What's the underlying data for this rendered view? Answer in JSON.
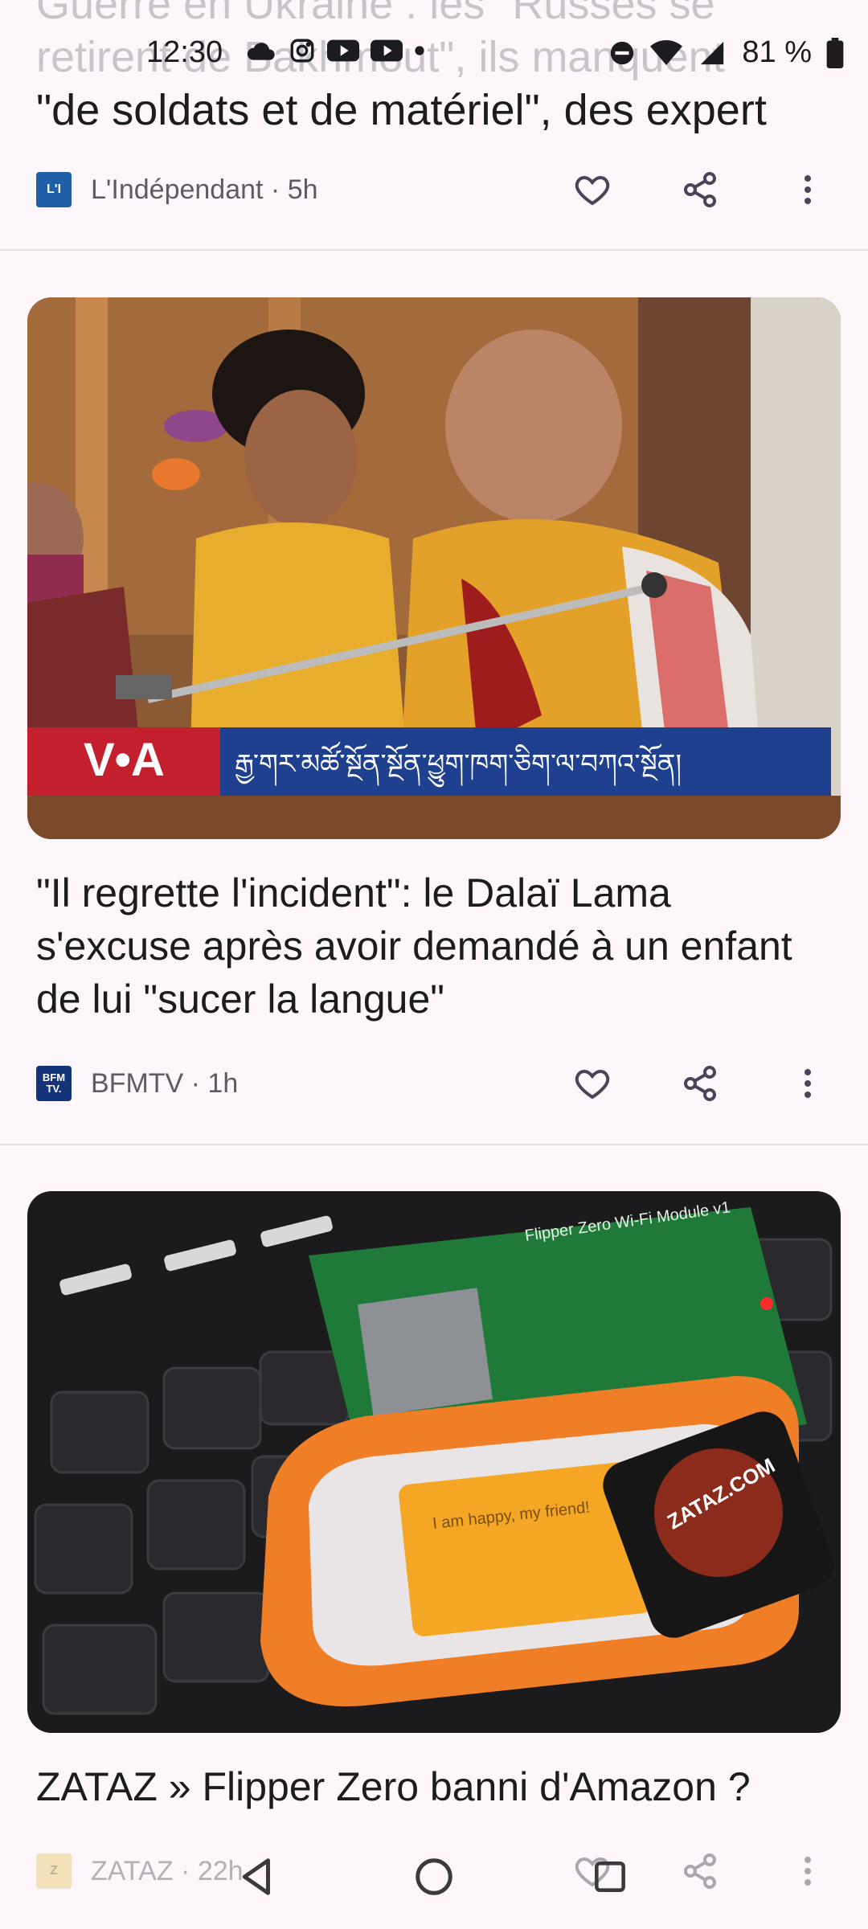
{
  "status_bar": {
    "time": "12:30",
    "battery": "81 %",
    "icons": [
      "cloud-icon",
      "instagram-icon",
      "youtube-icon",
      "youtube-icon",
      "dot-icon",
      "dnd-icon",
      "wifi-icon",
      "signal-icon",
      "battery-icon"
    ]
  },
  "articles": [
    {
      "title_faded": "Guerre en Ukraine : les \"Russes se retirent de Bakhmout\", ils manquent",
      "title_visible": "\"de soldats et de matériel\", des expert",
      "source": "L'Indépendant",
      "age": "5h",
      "source_meta": "L'Indépendant · 5h",
      "logo_text": "L'I",
      "logo_color": "#1e5fa8"
    },
    {
      "title": "\"Il regrette l'incident\": le Dalaï Lama s'excuse après avoir demandé à un enfant de lui \"sucer la langue\"",
      "source": "BFMTV",
      "age": "1h",
      "source_meta": "BFMTV · 1h",
      "logo_text": "BFM TV.",
      "logo_color": "#14347a",
      "image_caption_voa": "V•A",
      "image_caption_tibetan": "རྒྱ་གར་མཚོ་སྔོན་སྔོན་ཕྱུག་ཁག་ཅིག་ལ་བཀའ་སྔོན།"
    },
    {
      "title": "ZATAZ » Flipper Zero banni d'Amazon ?",
      "source": "ZATAZ",
      "age": "22h",
      "source_meta": "ZATAZ · 22h",
      "logo_text": "Z",
      "logo_color": "#e8c96a",
      "image_screen_text": "I am happy, my friend!",
      "image_badge_text": "ZATAZ.COM",
      "image_board_text": "Flipper Zero Wi-Fi Module v1"
    }
  ],
  "actions": {
    "like": "heart-icon",
    "share": "share-icon",
    "more": "more-vert-icon"
  },
  "nav": {
    "back": "back-icon",
    "home": "home-icon",
    "recents": "recents-icon"
  },
  "colors": {
    "background": "#fdf7fb",
    "divider": "#e4dee6",
    "text": "#1c1b1f",
    "meta": "#5f5b66"
  }
}
